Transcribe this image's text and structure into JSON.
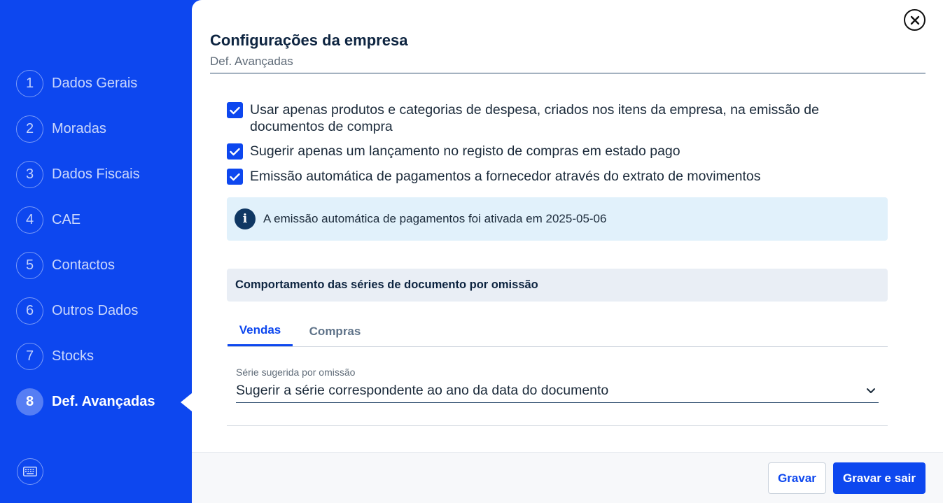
{
  "sidebar": {
    "steps": [
      {
        "num": "1",
        "label": "Dados Gerais"
      },
      {
        "num": "2",
        "label": "Moradas"
      },
      {
        "num": "3",
        "label": "Dados Fiscais"
      },
      {
        "num": "4",
        "label": "CAE"
      },
      {
        "num": "5",
        "label": "Contactos"
      },
      {
        "num": "6",
        "label": "Outros Dados"
      },
      {
        "num": "7",
        "label": "Stocks"
      },
      {
        "num": "8",
        "label": "Def. Avançadas"
      }
    ],
    "active_step": "8",
    "keyboard_icon": "keyboard-icon"
  },
  "header": {
    "title": "Configurações da empresa",
    "subtitle": "Def. Avançadas",
    "close_icon": "close-icon"
  },
  "options": [
    {
      "label": "Usar apenas produtos e categorias de despesa, criados nos itens da empresa, na emissão de documentos de compra",
      "checked": true
    },
    {
      "label": "Sugerir apenas um lançamento no registo de compras em estado pago",
      "checked": true
    },
    {
      "label": "Emissão automática de pagamentos a fornecedor através do extrato de movimentos",
      "checked": true
    }
  ],
  "info": {
    "icon": "info-icon",
    "text": "A emissão automática de pagamentos foi ativada em 2025-05-06"
  },
  "series_section": {
    "title": "Comportamento das séries de documento por omissão",
    "tabs": [
      {
        "label": "Vendas",
        "active": true
      },
      {
        "label": "Compras",
        "active": false
      }
    ],
    "select_label": "Série sugerida por omissão",
    "select_value": "Sugerir a série correspondente ao ano da data do documento"
  },
  "footer": {
    "save_label": "Gravar",
    "save_exit_label": "Gravar e sair"
  },
  "colors": {
    "brand": "#0d47ef",
    "info_bg": "#e1f1fb",
    "section_bg": "#e9eef5",
    "title": "#0d2440"
  }
}
